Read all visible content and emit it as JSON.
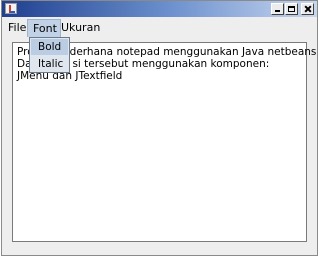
{
  "window": {
    "title": "",
    "accent_gradient": [
      "#1f3f8f",
      "#6f93cf",
      "#c8d6ee"
    ]
  },
  "menubar": {
    "file": "File",
    "font": "Font",
    "ukuran": "Ukuran"
  },
  "font_menu": {
    "items": [
      "Bold",
      "Italic"
    ]
  },
  "editor": {
    "line1_visible": "Pro",
    "line1_rest": "derhana notepad menggunakan Java netbeans",
    "line2_visible": "Dal",
    "line2_rest": "si tersebut menggunakan komponen:",
    "line3": "JMenu dan JTextfield"
  }
}
